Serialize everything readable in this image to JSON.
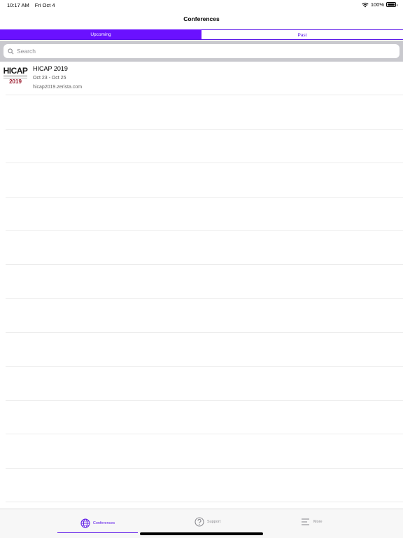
{
  "status": {
    "time": "10:17 AM",
    "date": "Fri Oct 4",
    "battery": "100%"
  },
  "nav": {
    "title": "Conferences"
  },
  "segments": [
    {
      "label": "Upcoming",
      "selected": true
    },
    {
      "label": "Past",
      "selected": false
    }
  ],
  "search": {
    "placeholder": "Search",
    "value": ""
  },
  "conferences": [
    {
      "logo_text": "HICAP",
      "logo_year": "2019",
      "title": "HICAP 2019",
      "dates": "Oct 23 - Oct 25",
      "url": "hicap2019.zerista.com"
    }
  ],
  "tabs": [
    {
      "label": "Conferences",
      "icon": "globe-icon",
      "selected": true
    },
    {
      "label": "Support",
      "icon": "question-circle-icon",
      "selected": false
    },
    {
      "label": "More",
      "icon": "menu-lines-icon",
      "selected": false
    }
  ],
  "colors": {
    "accent": "#6a11ff",
    "logo_year": "#9b1b2e",
    "search_bg": "#c9c9ce"
  }
}
